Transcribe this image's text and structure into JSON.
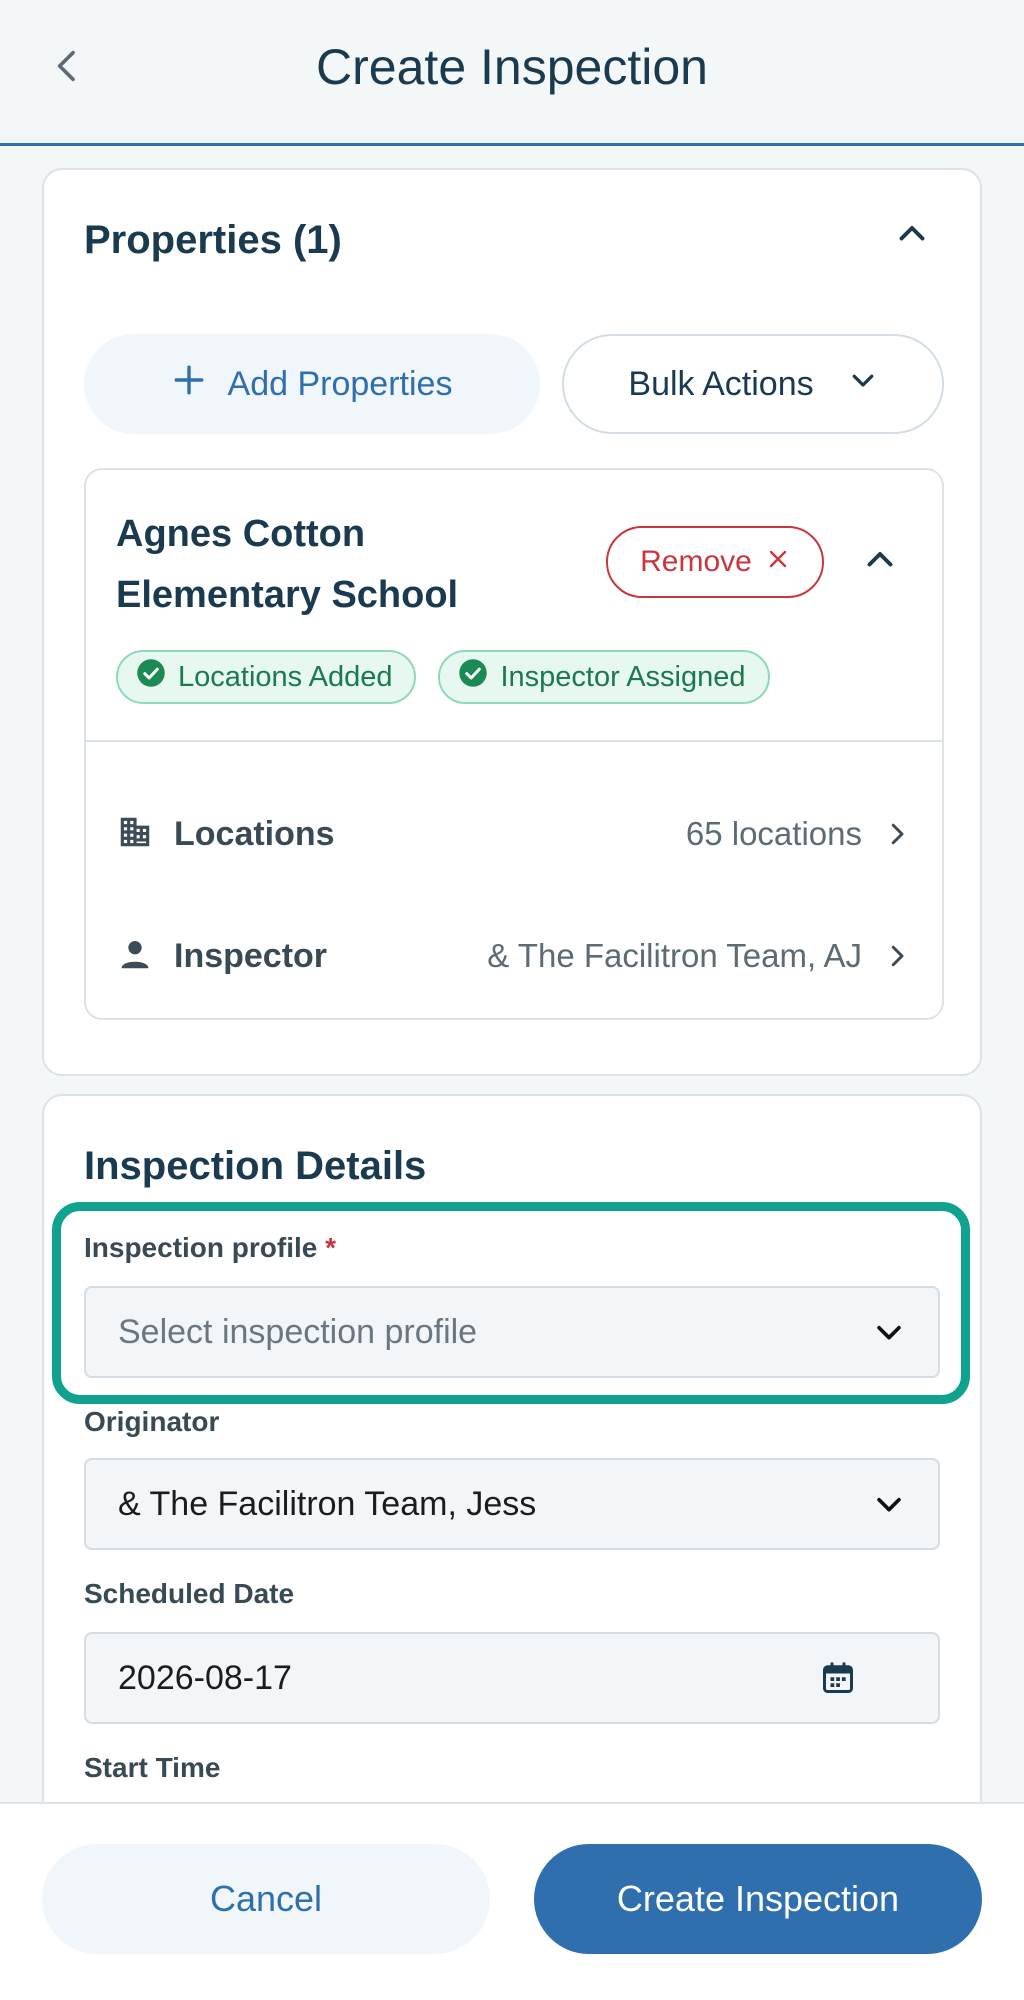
{
  "header": {
    "title": "Create Inspection",
    "back_icon": "chevron-left-icon"
  },
  "properties": {
    "title": "Properties (1)",
    "add_label": "Add Properties",
    "bulk_label": "Bulk Actions",
    "property": {
      "name": "Agnes Cotton Elementary School",
      "remove_label": "Remove",
      "badges": [
        "Locations Added",
        "Inspector Assigned"
      ],
      "locations_label": "Locations",
      "locations_value": "65 locations",
      "inspector_label": "Inspector",
      "inspector_value": "& The Facilitron Team, AJ"
    }
  },
  "details": {
    "title": "Inspection Details",
    "profile_label": "Inspection profile",
    "profile_required": "*",
    "profile_placeholder": "Select inspection profile",
    "originator_label": "Originator",
    "originator_value": "& The Facilitron Team, Jess",
    "date_label": "Scheduled Date",
    "date_value": "2026-08-17",
    "start_time_label": "Start Time"
  },
  "footer": {
    "cancel_label": "Cancel",
    "create_label": "Create Inspection"
  },
  "colors": {
    "primary": "#2f6fae",
    "danger": "#c9363e",
    "success": "#1b7a4d",
    "highlight": "#0fa38f"
  }
}
